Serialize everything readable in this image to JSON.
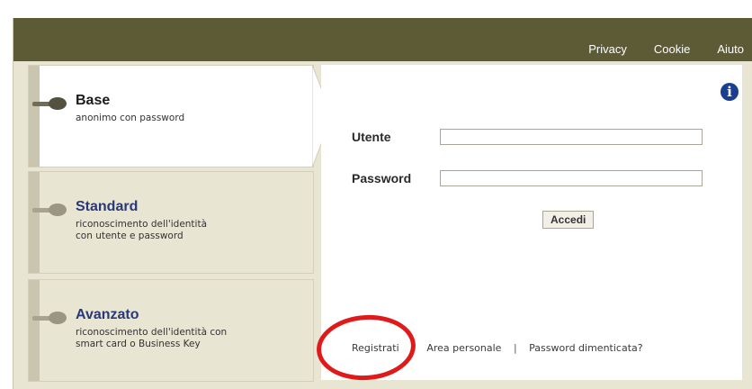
{
  "nav": {
    "privacy": "Privacy",
    "cookie": "Cookie",
    "aiuto": "Aiuto"
  },
  "levels": [
    {
      "title": "Base",
      "desc": "anonimo con password",
      "active": true
    },
    {
      "title": "Standard",
      "desc": "riconoscimento dell'identità\ncon utente e password",
      "active": false
    },
    {
      "title": "Avanzato",
      "desc": "riconoscimento dell'identità con\nsmart card o Business Key",
      "active": false
    }
  ],
  "login": {
    "user_label": "Utente",
    "user_value": "",
    "password_label": "Password",
    "password_value": "",
    "submit_label": "Accedi"
  },
  "links": {
    "register": "Registrati",
    "personal_area": "Area personale",
    "forgot_password": "Password dimenticata?",
    "separator": "|"
  },
  "icons": {
    "info": "info-icon",
    "level_knob": "toggle-knob-icon"
  },
  "colors": {
    "topbar": "#5d5a36",
    "panel_bg": "#e8e5d3",
    "accent_blue": "#28387a",
    "highlight_circle": "#e01a1a"
  }
}
